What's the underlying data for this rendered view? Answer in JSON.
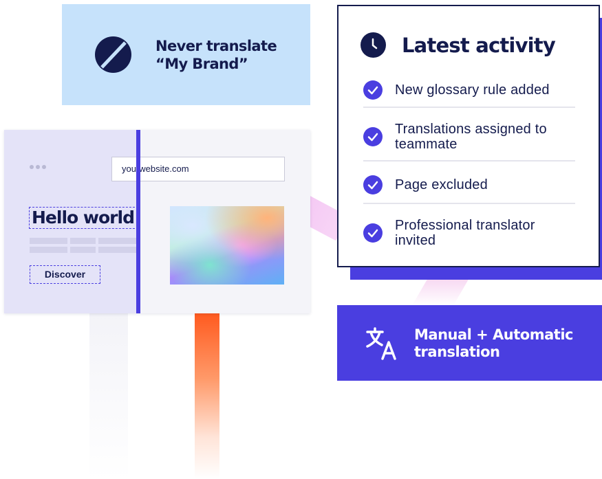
{
  "brand_card": {
    "icon": "no-translate-icon",
    "line1": "Never translate",
    "line2": "“My Brand”",
    "background": "#c6e2fb"
  },
  "browser_mockup": {
    "url": "yourwebsite.com",
    "heading": "Hello world",
    "button_label": "Discover",
    "accent": "#4a3ee0"
  },
  "activity": {
    "icon": "clock-icon",
    "title": "Latest activity",
    "items": [
      {
        "icon": "check-circle-icon",
        "label": "New glossary rule added"
      },
      {
        "icon": "check-circle-icon",
        "label": "Translations assigned to teammate"
      },
      {
        "icon": "check-circle-icon",
        "label": "Page excluded"
      },
      {
        "icon": "check-circle-icon",
        "label": "Professional translator invited"
      }
    ]
  },
  "translation_card": {
    "icon": "translate-icon",
    "line1": "Manual + Automatic",
    "line2": "translation",
    "background": "#4a3ee0"
  },
  "colors": {
    "navy": "#141b4d",
    "indigo": "#4a3ee0",
    "orange": "#ff5a1f"
  }
}
